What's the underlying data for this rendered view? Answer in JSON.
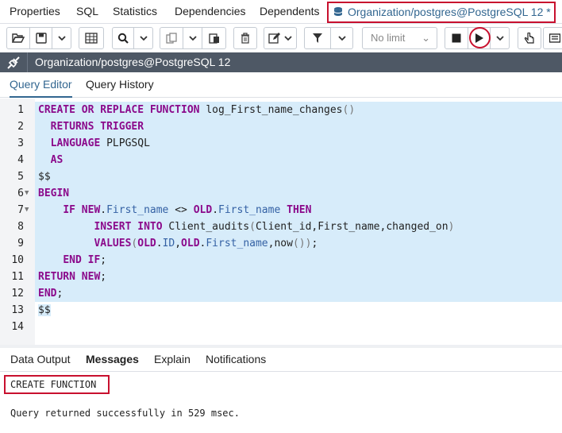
{
  "top_tabs": [
    "Properties",
    "SQL",
    "Statistics",
    "Dependencies",
    "Dependents"
  ],
  "active_tab": "Organization/postgres@PostgreSQL 12 *",
  "toolbar": {
    "limit_placeholder": "No limit"
  },
  "connection": {
    "label": "Organization/postgres@PostgreSQL 12"
  },
  "editor_tabs": [
    "Query Editor",
    "Query History"
  ],
  "code_lines": [
    {
      "n": "1",
      "fold": false
    },
    {
      "n": "2",
      "fold": false
    },
    {
      "n": "3",
      "fold": false
    },
    {
      "n": "4",
      "fold": false
    },
    {
      "n": "5",
      "fold": false
    },
    {
      "n": "6",
      "fold": true
    },
    {
      "n": "7",
      "fold": true
    },
    {
      "n": "8",
      "fold": false
    },
    {
      "n": "9",
      "fold": false
    },
    {
      "n": "10",
      "fold": false
    },
    {
      "n": "11",
      "fold": false
    },
    {
      "n": "12",
      "fold": false
    },
    {
      "n": "13",
      "fold": false
    },
    {
      "n": "14",
      "fold": false
    }
  ],
  "code": {
    "l1": {
      "t1": "CREATE OR REPLACE FUNCTION",
      "t2": " log_First_name_changes",
      "t3": "()"
    },
    "l2": {
      "t1": "  RETURNS TRIGGER"
    },
    "l3": {
      "t1": "  LANGUAGE",
      "t2": " PLPGSQL"
    },
    "l4": {
      "t1": "  AS"
    },
    "l5": {
      "t1": "$$"
    },
    "l6": {
      "t1": "BEGIN"
    },
    "l7": {
      "t0": "    ",
      "t1": "IF NEW",
      "t2": ".",
      "t3": "First_name",
      "t4": " <> ",
      "t5": "OLD",
      "t6": ".",
      "t7": "First_name",
      "t8": " THEN"
    },
    "l8": {
      "t0": "         ",
      "t1": "INSERT INTO",
      "t2": " Client_audits",
      "t3": "(",
      "t4": "Client_id,First_name,changed_on",
      "t5": ")"
    },
    "l9": {
      "t0": "         ",
      "t1": "VALUES",
      "t2": "(",
      "t3": "OLD",
      "t4": ".",
      "t5": "ID",
      "t6": ",",
      "t7": "OLD",
      "t8": ".",
      "t9": "First_name",
      "t10": ",now",
      "t11": "())",
      "t12": ";"
    },
    "l10": {
      "t0": "    ",
      "t1": "END IF",
      "t2": ";"
    },
    "l11": {
      "t1": "RETURN NEW",
      "t2": ";"
    },
    "l12": {
      "t1": "END",
      "t2": ";"
    },
    "l13": {
      "t1": "$$"
    },
    "l14": {
      "t1": ""
    }
  },
  "result_tabs": [
    "Data Output",
    "Messages",
    "Explain",
    "Notifications"
  ],
  "messages": {
    "status": "CREATE FUNCTION",
    "detail": "Query returned successfully in 529 msec."
  },
  "colors": {
    "accent": "#326690",
    "highlight": "#c8102e",
    "selection": "#d7ecfa",
    "keyword": "#8b0a8b",
    "connbar": "#4e5865"
  }
}
